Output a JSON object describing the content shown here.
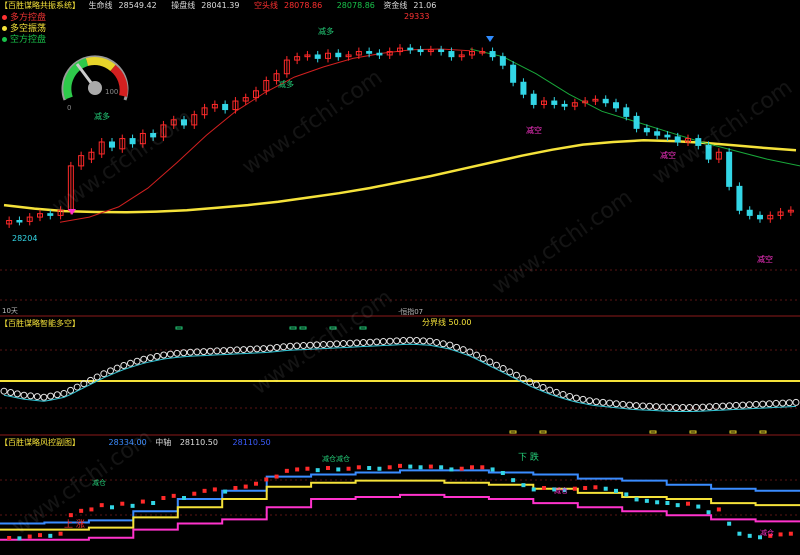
{
  "panel1": {
    "title": "【百胜谋略共振系统】",
    "indicators": [
      {
        "label": "生命线",
        "value": "28549.42",
        "color": "#ffffff"
      },
      {
        "label": "操盘线",
        "value": "28041.39",
        "color": "#ffffff"
      },
      {
        "label": "空头线",
        "value": "28078.86",
        "color": "#ff3030"
      },
      {
        "label": "",
        "value": "28078.86",
        "color": "#19c24a"
      },
      {
        "label": "资金线",
        "value": "21.06",
        "color": "#ffffff"
      }
    ],
    "legend": [
      {
        "label": "多方控盘",
        "color": "#ff3333"
      },
      {
        "label": "多空振荡",
        "color": "#f5e23a"
      },
      {
        "label": "空方控盘",
        "color": "#19c24a"
      }
    ],
    "gauge": {
      "min": "0",
      "max": "100"
    },
    "high_label": "29333",
    "low_label": "28204",
    "right_low_label": "10天",
    "signals": [
      {
        "text": "减多",
        "color": "#24d07a"
      },
      {
        "text": "减多",
        "color": "#24d07a"
      },
      {
        "text": "减多",
        "color": "#24d07a"
      },
      {
        "text": "减空",
        "color": "#ff33cc"
      },
      {
        "text": "减空",
        "color": "#ff33cc"
      },
      {
        "text": "减空",
        "color": "#ff33cc"
      }
    ]
  },
  "panel2": {
    "title": "【百胜谋略智能多空】",
    "mid_label": "·恒指07",
    "line_label": "分界线 50.00"
  },
  "panel3": {
    "title": "【百胜谋略风控副图】",
    "values": [
      {
        "label": "",
        "value": "28334.00",
        "color": "#3a8cff"
      },
      {
        "label": "中轴",
        "value": "28110.50",
        "color": "#ffffff"
      },
      {
        "label": "",
        "value": "28110.50",
        "color": "#3a5cff"
      }
    ],
    "up_label": "上 涨",
    "down_label": "下 跌",
    "cang": [
      "减仓",
      "减仓减仓",
      "减仓",
      "减仓"
    ]
  },
  "watermark": "www.cfchi.com",
  "chart_data": [
    {
      "type": "candlestick",
      "title": "【百胜谋略共振系统】",
      "ylim": [
        27950,
        29450
      ],
      "annotations": {
        "high": 29333,
        "low": 28204
      },
      "series": [
        {
          "name": "生命线",
          "color": "#f5e23a",
          "values": [
            28330,
            28310,
            28295,
            28290,
            28288,
            28292,
            28300,
            28315,
            28330,
            28350,
            28375,
            28400,
            28430,
            28465,
            28500,
            28540,
            28580,
            28620,
            28655,
            28685,
            28700,
            28710,
            28705,
            28695,
            28680,
            28665,
            28652
          ]
        },
        {
          "name": "操盘线",
          "color": "#d22020",
          "values": [
            28230,
            28260,
            28320,
            28430,
            28580,
            28740,
            28880,
            28990,
            29080,
            29140,
            29190,
            29220,
            29240,
            29245,
            29235
          ]
        }
      ],
      "candles": [
        [
          28220,
          28240
        ],
        [
          28240,
          28235
        ],
        [
          28235,
          28260
        ],
        [
          28260,
          28280
        ],
        [
          28280,
          28270
        ],
        [
          28270,
          28300
        ],
        [
          28300,
          28560
        ],
        [
          28560,
          28620
        ],
        [
          28600,
          28640
        ],
        [
          28630,
          28700
        ],
        [
          28700,
          28670
        ],
        [
          28660,
          28720
        ],
        [
          28720,
          28690
        ],
        [
          28690,
          28750
        ],
        [
          28750,
          28730
        ],
        [
          28730,
          28800
        ],
        [
          28800,
          28830
        ],
        [
          28830,
          28800
        ],
        [
          28800,
          28860
        ],
        [
          28860,
          28900
        ],
        [
          28900,
          28920
        ],
        [
          28920,
          28890
        ],
        [
          28890,
          28940
        ],
        [
          28940,
          28960
        ],
        [
          28960,
          29000
        ],
        [
          29000,
          29060
        ],
        [
          29060,
          29100
        ],
        [
          29100,
          29180
        ],
        [
          29180,
          29200
        ],
        [
          29200,
          29210
        ],
        [
          29210,
          29190
        ],
        [
          29190,
          29220
        ],
        [
          29220,
          29200
        ],
        [
          29200,
          29210
        ],
        [
          29210,
          29230
        ],
        [
          29230,
          29220
        ],
        [
          29220,
          29210
        ],
        [
          29210,
          29230
        ],
        [
          29230,
          29250
        ],
        [
          29250,
          29240
        ],
        [
          29240,
          29230
        ],
        [
          29230,
          29240
        ],
        [
          29240,
          29230
        ],
        [
          29230,
          29200
        ],
        [
          29200,
          29210
        ],
        [
          29210,
          29230
        ],
        [
          29230,
          29230
        ],
        [
          29230,
          29200
        ],
        [
          29200,
          29150
        ],
        [
          29150,
          29050
        ],
        [
          29050,
          28980
        ],
        [
          28980,
          28920
        ],
        [
          28920,
          28940
        ],
        [
          28940,
          28920
        ],
        [
          28920,
          28910
        ],
        [
          28910,
          28930
        ],
        [
          28930,
          28940
        ],
        [
          28940,
          28950
        ],
        [
          28950,
          28930
        ],
        [
          28930,
          28900
        ],
        [
          28900,
          28850
        ],
        [
          28850,
          28780
        ],
        [
          28780,
          28760
        ],
        [
          28760,
          28740
        ],
        [
          28740,
          28730
        ],
        [
          28730,
          28700
        ],
        [
          28700,
          28720
        ],
        [
          28720,
          28680
        ],
        [
          28680,
          28600
        ],
        [
          28600,
          28640
        ],
        [
          28640,
          28440
        ],
        [
          28440,
          28300
        ],
        [
          28300,
          28270
        ],
        [
          28270,
          28250
        ],
        [
          28250,
          28270
        ],
        [
          28270,
          28290
        ],
        [
          28290,
          28300
        ]
      ]
    },
    {
      "type": "line",
      "title": "【百胜谋略智能多空】",
      "ylim": [
        0,
        100
      ],
      "series": [
        {
          "name": "分界线",
          "color": "#f5e23a",
          "values": [
            50
          ]
        },
        {
          "name": "智能多空",
          "color": "#ffffff",
          "values": [
            40,
            36,
            34,
            38,
            48,
            58,
            66,
            72,
            76,
            78,
            79,
            80,
            81,
            82,
            84,
            85,
            86,
            87,
            88,
            89,
            90,
            89,
            85,
            78,
            68,
            58,
            48,
            40,
            34,
            30,
            28,
            26,
            25,
            24,
            24,
            25,
            26,
            27,
            28,
            29
          ]
        }
      ]
    },
    {
      "type": "line",
      "title": "【百胜谋略风控副图】",
      "ylim": [
        27950,
        28450
      ],
      "series": [
        {
          "name": "上轨",
          "color": "#3a8cff",
          "values": [
            28080,
            28085,
            28095,
            28140,
            28200,
            28240,
            28310,
            28320,
            28330,
            28340,
            28340,
            28330,
            28320,
            28300,
            28290,
            28270,
            28250,
            28240
          ]
        },
        {
          "name": "中轴",
          "color": "#f5e23a",
          "values": [
            28050,
            28050,
            28060,
            28110,
            28160,
            28200,
            28260,
            28280,
            28290,
            28290,
            28280,
            28270,
            28250,
            28230,
            28210,
            28200,
            28180,
            28170
          ]
        },
        {
          "name": "下轨",
          "color": "#ff33cc",
          "values": [
            28000,
            28000,
            28010,
            28050,
            28080,
            28100,
            28160,
            28200,
            28210,
            28220,
            28210,
            28200,
            28180,
            28160,
            28140,
            28120,
            28100,
            28090
          ]
        }
      ]
    }
  ]
}
